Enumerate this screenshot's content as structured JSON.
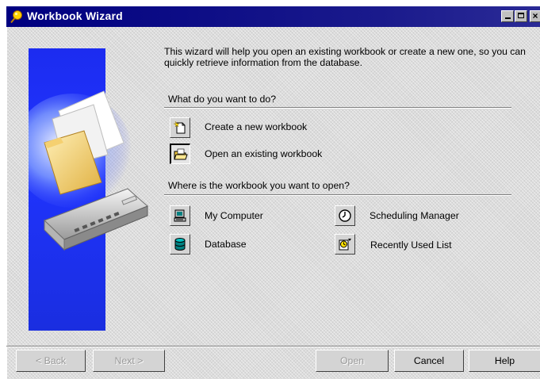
{
  "window": {
    "title": "Workbook Wizard",
    "icon": "wizard-pin-icon",
    "controls": {
      "minimize": "_",
      "maximize": "□",
      "close": "×"
    }
  },
  "intro_text": "This wizard will help you open an existing workbook or create a new one, so you can quickly retrieve information from the database.",
  "sections": {
    "what_label": "What do you want to do?",
    "where_label": "Where is the workbook you want to open?"
  },
  "actions": [
    {
      "label": "Create a new workbook",
      "icon": "new-document-icon",
      "selected": false
    },
    {
      "label": "Open an existing workbook",
      "icon": "open-folder-icon",
      "selected": true
    }
  ],
  "locations": [
    {
      "label": "My Computer",
      "icon": "computer-icon"
    },
    {
      "label": "Scheduling Manager",
      "icon": "clock-icon"
    },
    {
      "label": "Database",
      "icon": "database-icon"
    },
    {
      "label": "Recently Used List",
      "icon": "recent-list-icon"
    }
  ],
  "buttons": {
    "back": "< Back",
    "next": "Next >",
    "open": "Open",
    "cancel": "Cancel",
    "help": "Help"
  }
}
